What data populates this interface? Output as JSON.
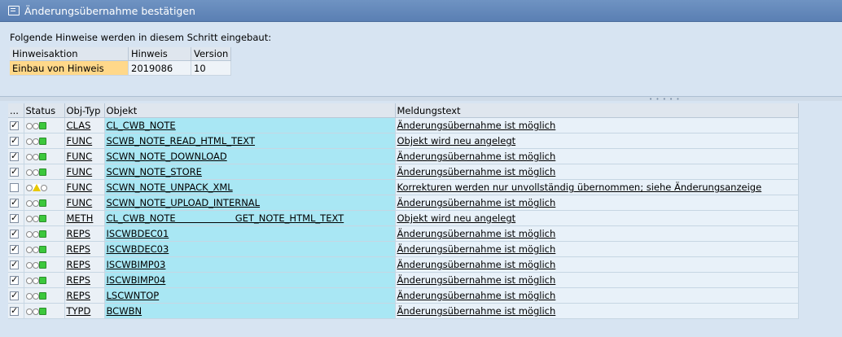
{
  "window": {
    "title": "Änderungsübernahme bestätigen"
  },
  "intro_text": "Folgende Hinweise werden in diesem Schritt eingebaut:",
  "notes_table": {
    "headers": [
      "Hinweisaktion",
      "Hinweis",
      "Version"
    ],
    "rows": [
      [
        "Einbau von Hinweis",
        "2019086",
        "10"
      ]
    ]
  },
  "grid": {
    "headers": [
      "...",
      "Status",
      "Obj-Typ",
      "Objekt",
      "Meldungstext"
    ],
    "rows": [
      {
        "checked": true,
        "status": "green",
        "type": "CLAS",
        "object": "CL_CWB_NOTE",
        "message": "Änderungsübernahme ist möglich"
      },
      {
        "checked": true,
        "status": "green",
        "type": "FUNC",
        "object": "SCWB_NOTE_READ_HTML_TEXT",
        "message": "Objekt wird neu angelegt"
      },
      {
        "checked": true,
        "status": "green",
        "type": "FUNC",
        "object": "SCWN_NOTE_DOWNLOAD",
        "message": "Änderungsübernahme ist möglich"
      },
      {
        "checked": true,
        "status": "green",
        "type": "FUNC",
        "object": "SCWN_NOTE_STORE",
        "message": "Änderungsübernahme ist möglich"
      },
      {
        "checked": false,
        "status": "yellow",
        "type": "FUNC",
        "object": "SCWN_NOTE_UNPACK_XML",
        "message": "Korrekturen werden nur unvollständig übernommen; siehe Änderungsanzeige"
      },
      {
        "checked": true,
        "status": "green",
        "type": "FUNC",
        "object": "SCWN_NOTE_UPLOAD_INTERNAL",
        "message": "Änderungsübernahme ist möglich"
      },
      {
        "checked": true,
        "status": "green",
        "type": "METH",
        "object": "CL_CWB_NOTE                    GET_NOTE_HTML_TEXT",
        "message": "Objekt wird neu angelegt"
      },
      {
        "checked": true,
        "status": "green",
        "type": "REPS",
        "object": "ISCWBDEC01",
        "message": "Änderungsübernahme ist möglich"
      },
      {
        "checked": true,
        "status": "green",
        "type": "REPS",
        "object": "ISCWBDEC03",
        "message": "Änderungsübernahme ist möglich"
      },
      {
        "checked": true,
        "status": "green",
        "type": "REPS",
        "object": "ISCWBIMP03",
        "message": "Änderungsübernahme ist möglich"
      },
      {
        "checked": true,
        "status": "green",
        "type": "REPS",
        "object": "ISCWBIMP04",
        "message": "Änderungsübernahme ist möglich"
      },
      {
        "checked": true,
        "status": "green",
        "type": "REPS",
        "object": "LSCWNTOP",
        "message": "Änderungsübernahme ist möglich"
      },
      {
        "checked": true,
        "status": "green",
        "type": "TYPD",
        "object": "BCWBN",
        "message": "Änderungsübernahme ist möglich"
      }
    ]
  }
}
